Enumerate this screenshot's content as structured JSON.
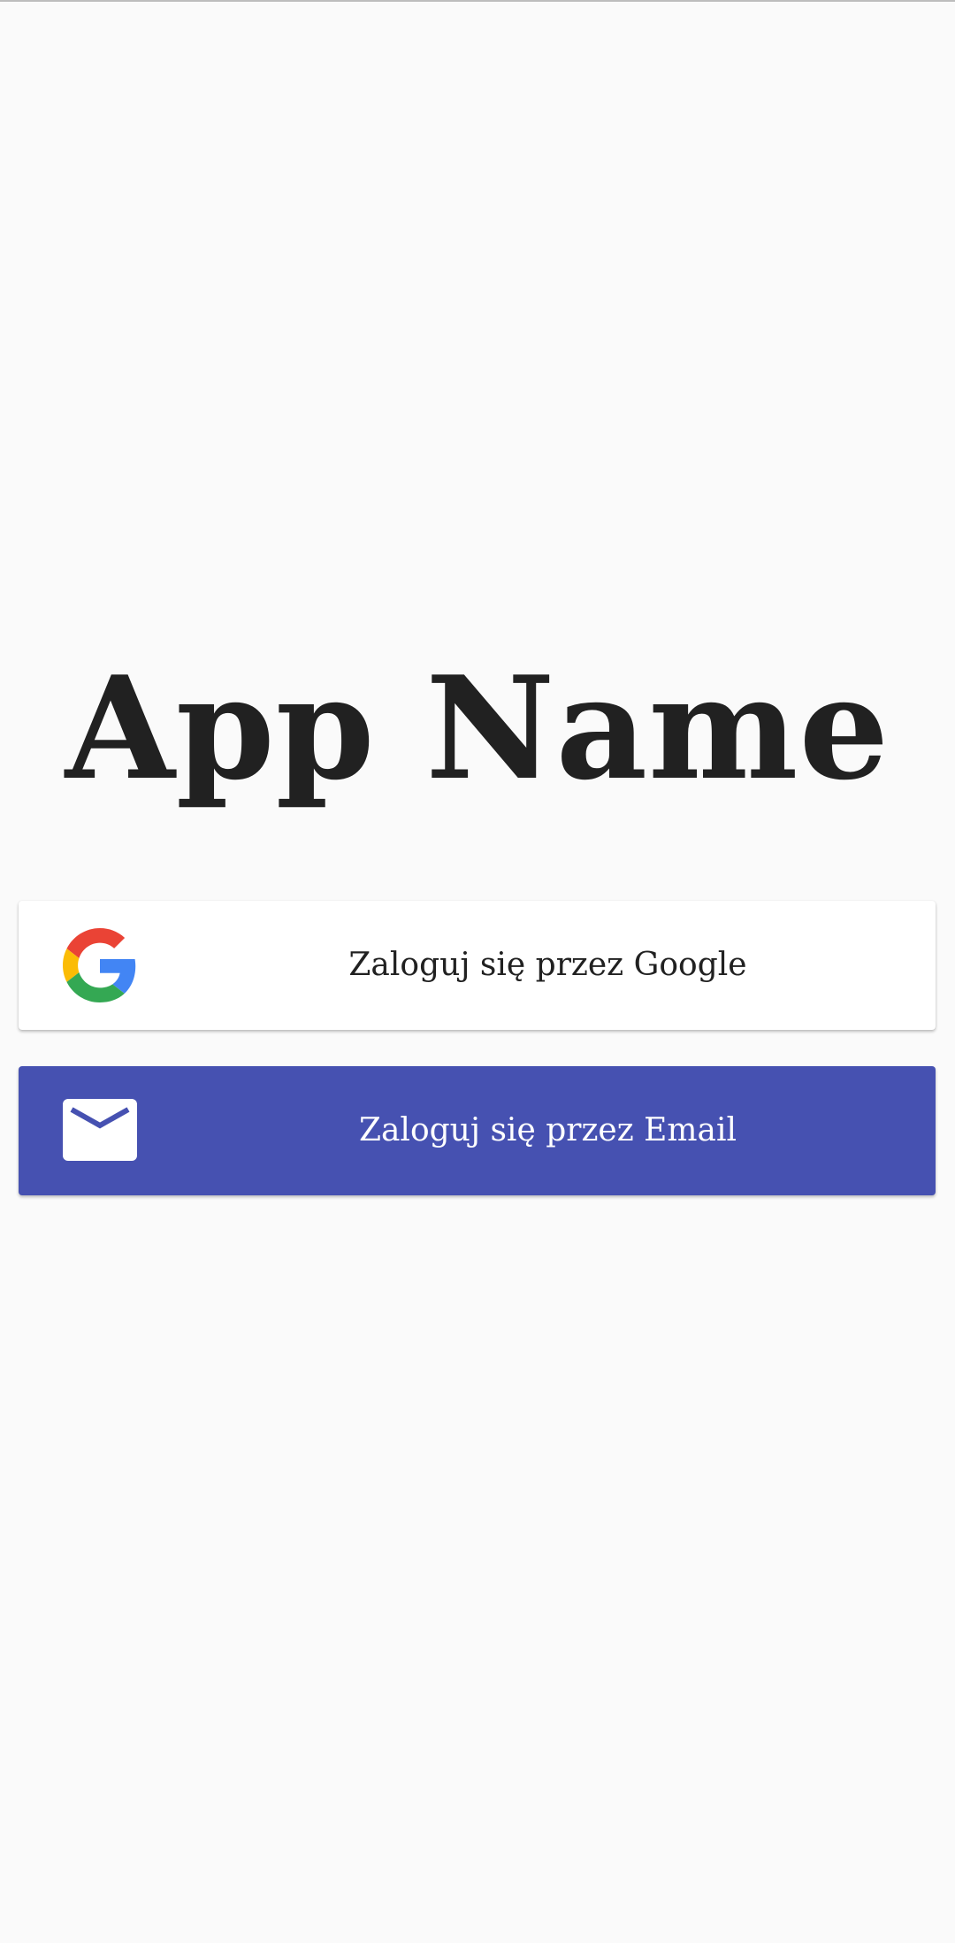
{
  "app": {
    "title": "App Name"
  },
  "buttons": {
    "google": {
      "label": "Zaloguj się przez Google",
      "icon": "google-icon"
    },
    "email": {
      "label": "Zaloguj się przez Email",
      "icon": "mail-icon"
    }
  },
  "colors": {
    "background": "#fafafa",
    "title": "#212121",
    "email_button": "#4651b1",
    "google_button": "#ffffff"
  }
}
